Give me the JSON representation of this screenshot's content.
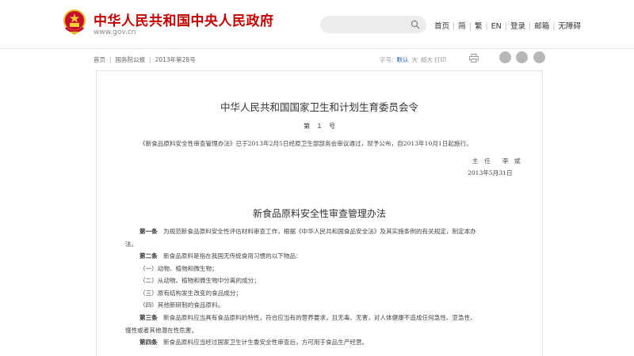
{
  "header": {
    "site_title": "中华人民共和国中央人民政府",
    "site_url": "www.gov.cn",
    "search_placeholder": "",
    "nav": [
      "首页",
      "简",
      "繁",
      "EN",
      "登录",
      "邮箱",
      "无障碍"
    ]
  },
  "toolbar": {
    "breadcrumb": [
      "首页",
      "国务院公报",
      "2013年第28号"
    ],
    "font_label": "字号:",
    "font_default": "默认",
    "font_large": "大",
    "font_xlarge": "超大",
    "print_label": "打印",
    "share_icons": [
      "weibo-icon",
      "wechat-icon",
      "favorite-icon"
    ]
  },
  "document": {
    "title": "中华人民共和国国家卫生和计划生育委员会令",
    "number": "第　１　号",
    "intro": "《新食品原料安全性审查管理办法》已于2013年2月5日经原卫生部部务会审议通过，现予公布，自2013年10月1日起施行。",
    "signer": "主　任　　李　斌",
    "date": "2013年5月31日",
    "regulation_title": "新食品原料安全性审查管理办法",
    "article1_label": "第一条",
    "article1_line1": "为规范新食品原料安全性评估材料审查工作，根据《中华人民共和国食品安全法》及其实施条例的有关规定，制定本办",
    "article1_line2": "法。",
    "article2_label": "第二条",
    "article2_line1": "新食品原料是指在我国无传统食用习惯的以下物品：",
    "item1": "（一）动物、植物和微生物；",
    "item2": "（二）从动物、植物和微生物中分离的成分；",
    "item3": "（三）原有结构发生改变的食品成分；",
    "item4": "（四）其他新研制的食品原料。",
    "article3_label": "第三条",
    "article3_line1": "新食品原料应当具有食品原料的特性，符合应当有的营养要求，且无毒、无害，对人体健康不造成任何急性、亚急性、",
    "article3_line2": "慢性或者其他潜在性危害。",
    "article4_label": "第四条",
    "article4_line1": "新食品原料应当经过国家卫生计生委安全性审查后，方可用于食品生产经营。"
  }
}
